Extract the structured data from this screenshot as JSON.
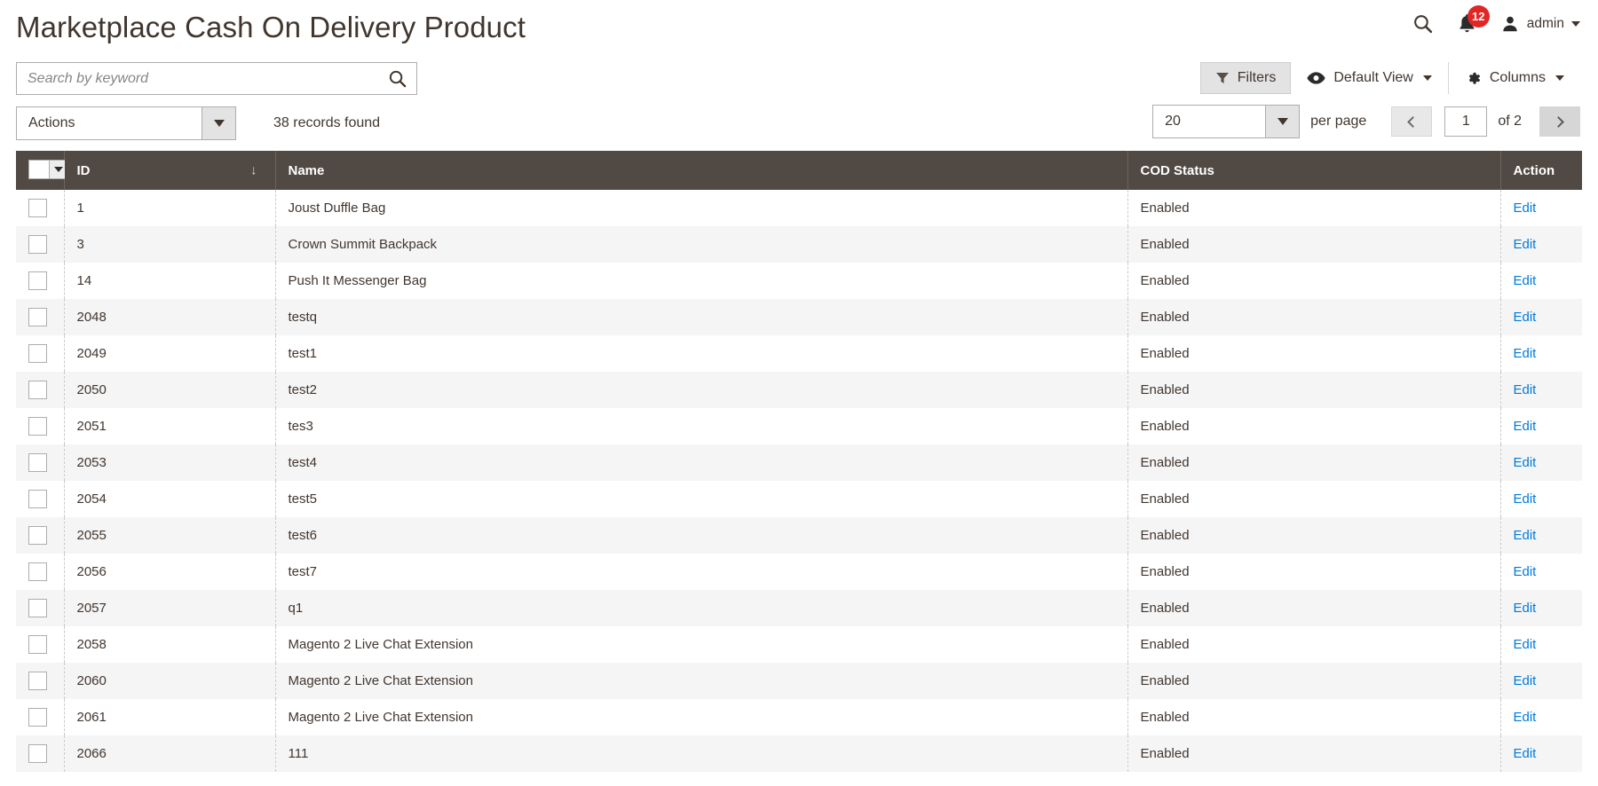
{
  "header": {
    "title": "Marketplace Cash On Delivery Product",
    "search_icon": "search-icon",
    "notifications_icon": "bell-icon",
    "notifications_count": "12",
    "user_icon": "user-avatar-icon",
    "user_name": "admin",
    "user_caret_icon": "chevron-down-icon"
  },
  "toolbar": {
    "search_placeholder": "Search by keyword",
    "search_value": "",
    "search_submit_icon": "search-icon",
    "filters_label": "Filters",
    "filters_icon": "funnel-icon",
    "view_label": "Default View",
    "view_icon": "eye-icon",
    "view_caret_icon": "chevron-down-icon",
    "columns_label": "Columns",
    "columns_icon": "gear-icon",
    "columns_caret_icon": "chevron-down-icon"
  },
  "controls": {
    "actions_label": "Actions",
    "actions_caret_icon": "chevron-down-icon",
    "records_found": "38 records found",
    "per_page_value": "20",
    "per_page_caret_icon": "chevron-down-icon",
    "per_page_label": "per page",
    "prev_icon": "chevron-left-icon",
    "next_icon": "chevron-right-icon",
    "current_page": "1",
    "total_pages_label": "of 2"
  },
  "grid": {
    "select_all_icon": "checkbox-dropdown-icon",
    "sort_icon": "sort-descending-arrow",
    "columns": [
      {
        "key": "id",
        "label": "ID"
      },
      {
        "key": "name",
        "label": "Name"
      },
      {
        "key": "cod",
        "label": "COD Status"
      },
      {
        "key": "action",
        "label": "Action"
      }
    ],
    "edit_label": "Edit",
    "rows": [
      {
        "id": "1",
        "name": "Joust Duffle Bag",
        "cod": "Enabled"
      },
      {
        "id": "3",
        "name": "Crown Summit Backpack",
        "cod": "Enabled"
      },
      {
        "id": "14",
        "name": "Push It Messenger Bag",
        "cod": "Enabled"
      },
      {
        "id": "2048",
        "name": "testq",
        "cod": "Enabled"
      },
      {
        "id": "2049",
        "name": "test1",
        "cod": "Enabled"
      },
      {
        "id": "2050",
        "name": "test2",
        "cod": "Enabled"
      },
      {
        "id": "2051",
        "name": "tes3",
        "cod": "Enabled"
      },
      {
        "id": "2053",
        "name": "test4",
        "cod": "Enabled"
      },
      {
        "id": "2054",
        "name": "test5",
        "cod": "Enabled"
      },
      {
        "id": "2055",
        "name": "test6",
        "cod": "Enabled"
      },
      {
        "id": "2056",
        "name": "test7",
        "cod": "Enabled"
      },
      {
        "id": "2057",
        "name": "q1",
        "cod": "Enabled"
      },
      {
        "id": "2058",
        "name": "Magento 2 Live Chat Extension",
        "cod": "Enabled"
      },
      {
        "id": "2060",
        "name": "Magento 2 Live Chat Extension",
        "cod": "Enabled"
      },
      {
        "id": "2061",
        "name": "Magento 2 Live Chat Extension",
        "cod": "Enabled"
      },
      {
        "id": "2066",
        "name": "111",
        "cod": "Enabled"
      }
    ]
  },
  "colors": {
    "header_bar": "#514943",
    "link": "#007bdb",
    "badge": "#e22626",
    "text": "#41362f"
  }
}
